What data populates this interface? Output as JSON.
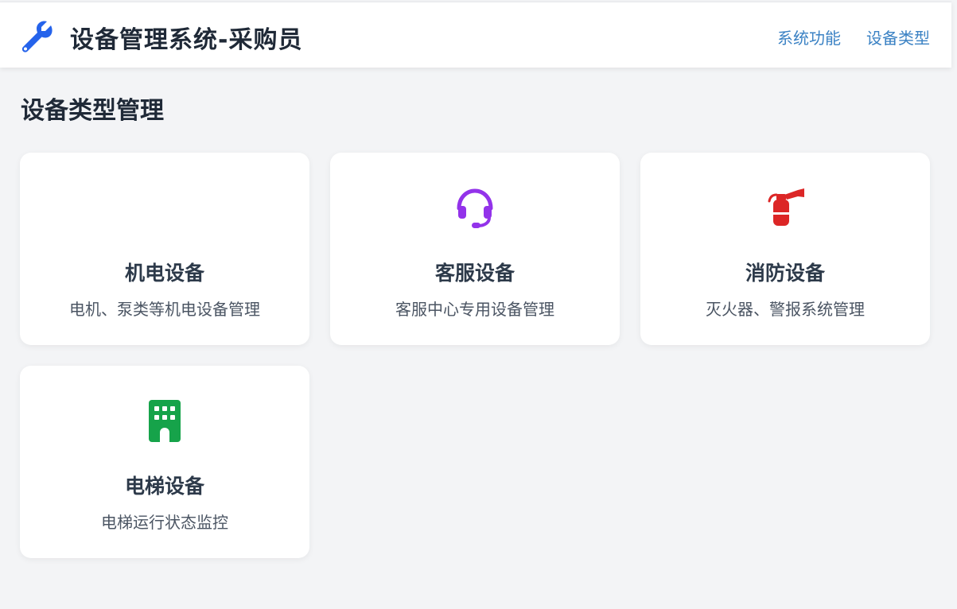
{
  "header": {
    "brand_icon": "wrench-icon",
    "title": "设备管理系统-采购员",
    "nav": [
      {
        "label": "系统功能"
      },
      {
        "label": "设备类型"
      }
    ]
  },
  "page": {
    "title": "设备类型管理"
  },
  "cards": [
    {
      "title": "机电设备",
      "description": "电机、泵类等机电设备管理",
      "icon": null,
      "color": null
    },
    {
      "title": "客服设备",
      "description": "客服中心专用设备管理",
      "icon": "headset-icon",
      "color": "#9333ea"
    },
    {
      "title": "消防设备",
      "description": "灭火器、警报系统管理",
      "icon": "fire-extinguisher-icon",
      "color": "#dc2626"
    },
    {
      "title": "电梯设备",
      "description": "电梯运行状态监控",
      "icon": "building-icon",
      "color": "#16a34a"
    }
  ],
  "colors": {
    "accent": "#2563eb",
    "nav_link": "#3b82c4",
    "background": "#f3f4f6"
  }
}
